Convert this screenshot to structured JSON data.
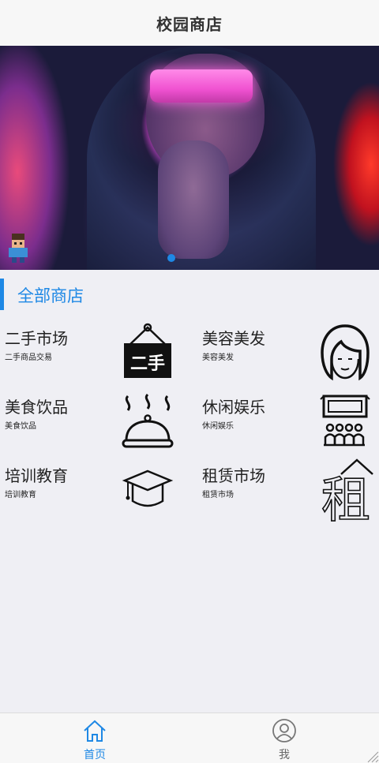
{
  "nav": {
    "title": "校园商店"
  },
  "section": {
    "title": "全部商店"
  },
  "categories": [
    {
      "name": "二手市场",
      "sub": "二手商品交易",
      "icon": "second-hand-sign-icon",
      "sign_text": "二手"
    },
    {
      "name": "美容美发",
      "sub": "美容美发",
      "icon": "woman-face-icon"
    },
    {
      "name": "美食饮品",
      "sub": "美食饮品",
      "icon": "food-cloche-icon"
    },
    {
      "name": "休闲娱乐",
      "sub": "休闲娱乐",
      "icon": "cinema-audience-icon"
    },
    {
      "name": "培训教育",
      "sub": "培训教育",
      "icon": "graduation-cap-icon"
    },
    {
      "name": "租赁市场",
      "sub": "租赁市场",
      "icon": "rent-house-icon",
      "sign_text": "租"
    }
  ],
  "tabbar": {
    "items": [
      {
        "label": "首页",
        "icon": "home-icon",
        "active": true
      },
      {
        "label": "我",
        "icon": "user-icon",
        "active": false
      }
    ]
  },
  "colors": {
    "accent": "#1e88e5",
    "background": "#efeff4",
    "bar": "#f7f7f7"
  }
}
